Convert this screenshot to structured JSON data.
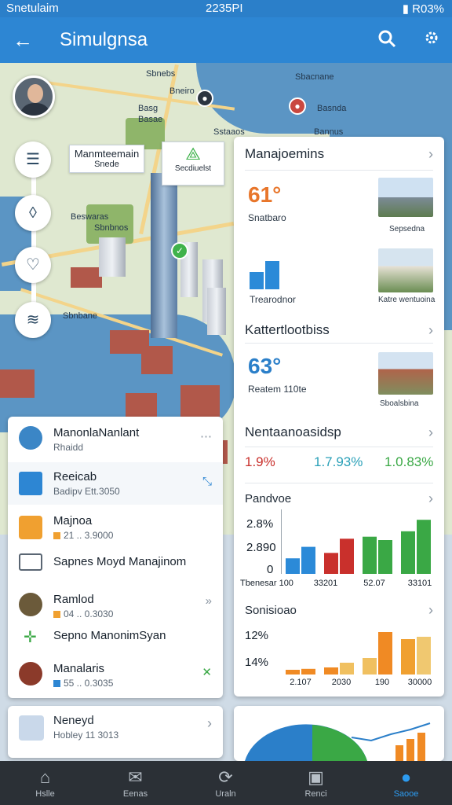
{
  "status": {
    "left": "Snetulaim",
    "time": "2235PI",
    "battery": "R03%"
  },
  "appbar": {
    "title": "Simulgnsa",
    "back_icon": "arrow-left-icon",
    "search_icon": "search-icon",
    "settings_icon": "gear-icon"
  },
  "map": {
    "labels": [
      "Sbnebs",
      "Bneiro",
      "Basg",
      "Basae",
      "Sstaaos",
      "Beswaras",
      "Sbnbnos",
      "Sbacnane",
      "Basnda",
      "Bannus",
      "Sbnbane"
    ],
    "callout1": {
      "line1": "Manmteemain",
      "line2": "Snede"
    },
    "callout2": {
      "label": "Secdiuelst"
    }
  },
  "right_panel": {
    "section1": {
      "title": "Manajoemins",
      "value": "61°",
      "value_label": "Snatbaro",
      "thumb1_caption": "Sepsedna",
      "chart_caption": "Trearodnor",
      "thumb2_caption": "Katre wentuoina"
    },
    "section2": {
      "title": "Kattertlootbiss",
      "value": "63°",
      "value_label": "Reatem 110te",
      "thumb_caption": "Sboalsbina"
    },
    "section3": {
      "title": "Nentaanoasidsp",
      "stat1": "1.9%",
      "stat2": "1.7.93%",
      "stat3": "1.0.83%"
    },
    "section4": {
      "title": "Pandvoe",
      "y_labels": [
        "2.8%",
        "2.890",
        "0"
      ],
      "x_labels": [
        "Tbenesar 100",
        "33201",
        "52.07",
        "33101"
      ]
    },
    "section5": {
      "title": "Sonisioao",
      "y_labels": [
        "12%",
        "14%"
      ],
      "x_labels": [
        "2.107",
        "2030",
        "190",
        "30000"
      ]
    }
  },
  "left_list": [
    {
      "title": "ManonlaNanlant",
      "subtitle": "Rhaidd",
      "trailing": "⋯",
      "icon": "nodes-icon"
    },
    {
      "title": "Reeicab",
      "subtitle": "Badipv Ett.3050",
      "trailing": "⤡",
      "icon": "monitor-icon"
    },
    {
      "title": "Majnoa",
      "subtitle": "21 .. 3.9000",
      "trailing": "",
      "icon": "wrench-icon"
    },
    {
      "title": "Sapnes Moyd Manajinom",
      "subtitle": "",
      "trailing": "",
      "icon": "card-icon"
    },
    {
      "title": "Ramlod",
      "subtitle": "04 .. 0.3030",
      "trailing": "»",
      "icon": "building-icon"
    },
    {
      "title": "Sepno ManonimSyan",
      "subtitle": "",
      "trailing": "",
      "icon": "crosshair-icon"
    },
    {
      "title": "Manalaris",
      "subtitle": "55 .. 0.3035",
      "trailing": "✕",
      "icon": "temple-icon"
    }
  ],
  "bottom_left_card": {
    "title": "Neneyd",
    "subtitle": "Hobley 11 3013",
    "trailing": "›"
  },
  "bottom_nav": [
    {
      "label": "Hslle",
      "icon": "home-icon"
    },
    {
      "label": "Eenas",
      "icon": "megaphone-icon"
    },
    {
      "label": "Uraln",
      "icon": "sync-icon"
    },
    {
      "label": "Renci",
      "icon": "chart-icon"
    },
    {
      "label": "Saooe",
      "icon": "user-icon"
    }
  ],
  "chart_data": [
    {
      "type": "bar",
      "title": "Pandvoe",
      "categories": [
        "Tbenesar 100",
        "33201",
        "52.07",
        "33101"
      ],
      "series": [
        {
          "values": [
            23,
            31,
            55,
            63
          ]
        },
        {
          "values": [
            40,
            52,
            50,
            80
          ]
        }
      ],
      "xlabel": "",
      "ylabel": "",
      "ylim": [
        0,
        100
      ],
      "grid": false
    },
    {
      "type": "bar",
      "title": "Sonisioao",
      "categories": [
        "2.107",
        "2030",
        "190",
        "30000"
      ],
      "series": [
        {
          "values": [
            10,
            15,
            35,
            75
          ]
        },
        {
          "values": [
            12,
            25,
            90,
            80
          ]
        }
      ],
      "xlabel": "",
      "ylabel": "",
      "grid": false
    }
  ]
}
